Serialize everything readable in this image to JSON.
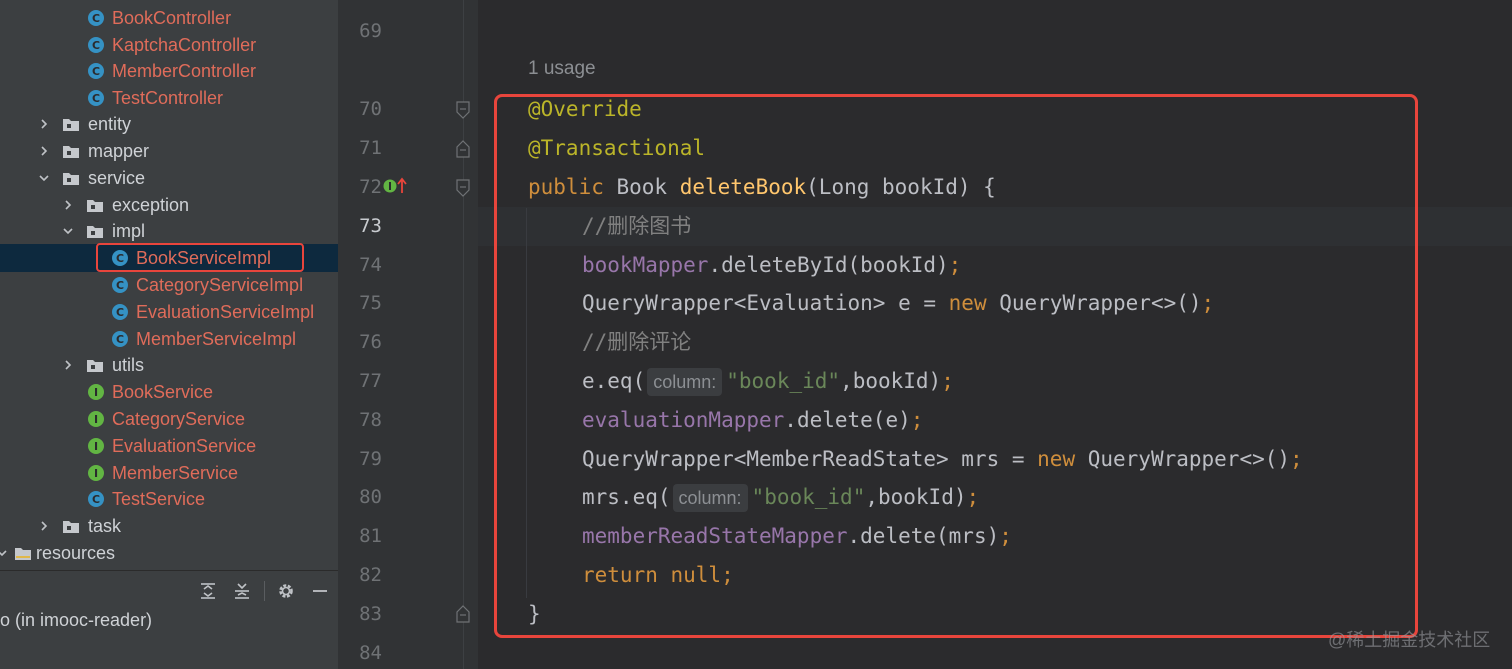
{
  "tree": {
    "items": [
      {
        "label": "BookController",
        "icon": "class-icon"
      },
      {
        "label": "KaptchaController",
        "icon": "class-icon"
      },
      {
        "label": "MemberController",
        "icon": "class-icon"
      },
      {
        "label": "TestController",
        "icon": "class-icon"
      },
      {
        "label": "entity",
        "icon": "package-icon"
      },
      {
        "label": "mapper",
        "icon": "package-icon"
      },
      {
        "label": "service",
        "icon": "package-icon"
      },
      {
        "label": "exception",
        "icon": "package-icon"
      },
      {
        "label": "impl",
        "icon": "package-icon"
      },
      {
        "label": "BookServiceImpl",
        "icon": "class-icon",
        "selected": true
      },
      {
        "label": "CategoryServiceImpl",
        "icon": "class-icon"
      },
      {
        "label": "EvaluationServiceImpl",
        "icon": "class-icon"
      },
      {
        "label": "MemberServiceImpl",
        "icon": "class-icon"
      },
      {
        "label": "utils",
        "icon": "package-icon"
      },
      {
        "label": "BookService",
        "icon": "interface-icon"
      },
      {
        "label": "CategoryService",
        "icon": "interface-icon"
      },
      {
        "label": "EvaluationService",
        "icon": "interface-icon"
      },
      {
        "label": "MemberService",
        "icon": "interface-icon"
      },
      {
        "label": "TestService",
        "icon": "class-icon"
      },
      {
        "label": "task",
        "icon": "package-icon"
      },
      {
        "label": "resources",
        "icon": "resources-folder-icon"
      }
    ],
    "run_label": "o (in imooc-reader)"
  },
  "gutter": {
    "line_numbers": [
      "69",
      "70",
      "71",
      "72",
      "73",
      "74",
      "75",
      "76",
      "77",
      "78",
      "79",
      "80",
      "81",
      "82",
      "83",
      "84"
    ],
    "current_line": "73"
  },
  "editor": {
    "usage_hint": "1 usage",
    "param_hint": "column:",
    "tokens": {
      "override": "@Override",
      "transactional": "@Transactional",
      "public": "public",
      "book": " Book ",
      "deleteBook": "deleteBook",
      "sig_rest": "(Long bookId) {",
      "cmt1": "//删除图书",
      "bookMapper": "bookMapper",
      "deleteById": ".deleteById(bookId)",
      "semi": ";",
      "qw_eval": "QueryWrapper<Evaluation> e = ",
      "new": "new",
      "qw_ctor": " QueryWrapper<>()",
      "cmt2": "//删除评论",
      "e_eq": "e.eq(",
      "book_id": "\"book_id\"",
      "comma_bookId": ",bookId)",
      "evaluationMapper": "evaluationMapper",
      "delete_e": ".delete(e)",
      "qw_mrs": "QueryWrapper<MemberReadState> mrs = ",
      "mrs_eq": "mrs.eq(",
      "memberReadStateMapper": "memberReadStateMapper",
      "delete_mrs": ".delete(mrs)",
      "return": "return",
      "null": " null",
      "close_brace": "}"
    }
  },
  "watermark": "@稀土掘金技术社区",
  "colors": {
    "accent_red": "#e8453c",
    "keyword": "#cf8e3c",
    "annotation": "#bbb529",
    "method": "#ffc66d",
    "field": "#9876aa",
    "string": "#6a8759",
    "comment": "#808080"
  }
}
